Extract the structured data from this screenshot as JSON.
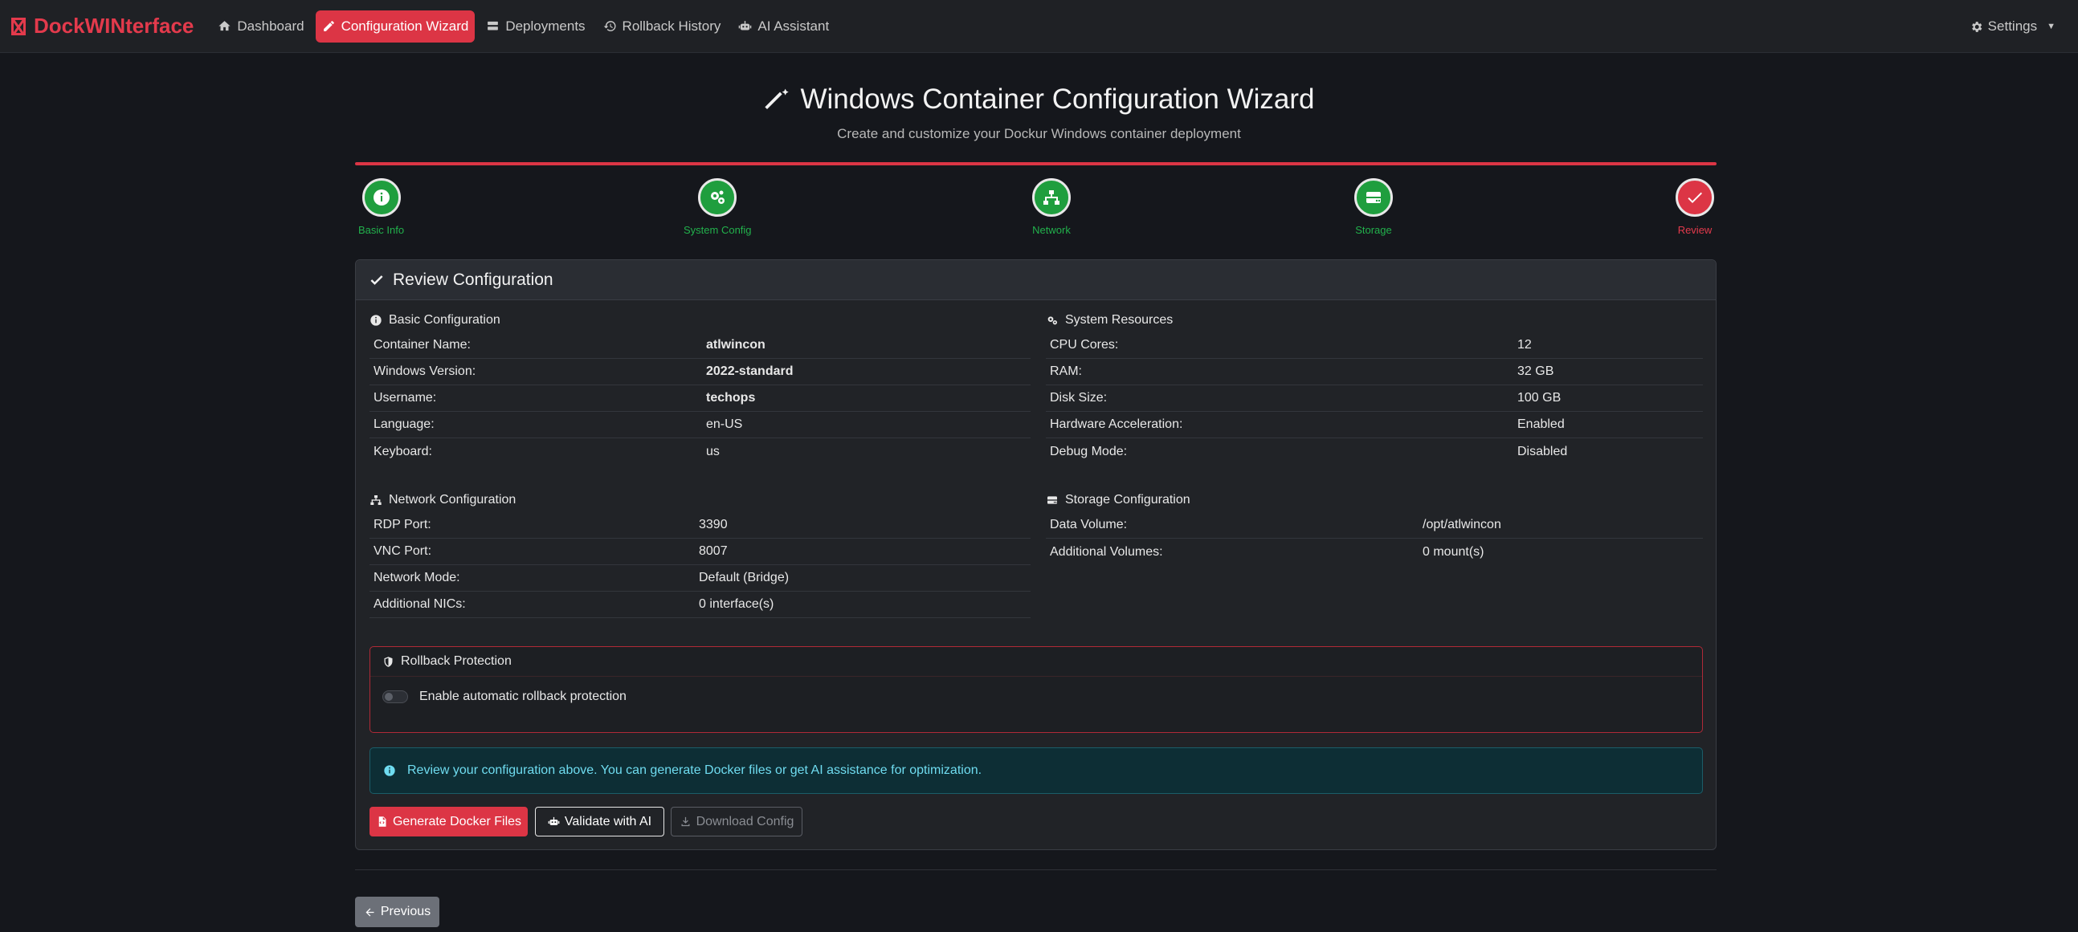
{
  "nav": {
    "brand": "DockWINterface",
    "items": [
      {
        "label": "Dashboard",
        "icon": "home-icon"
      },
      {
        "label": "Configuration Wizard",
        "icon": "pencil-icon"
      },
      {
        "label": "Deployments",
        "icon": "server-icon"
      },
      {
        "label": "Rollback History",
        "icon": "history-icon"
      },
      {
        "label": "AI Assistant",
        "icon": "robot-icon"
      }
    ],
    "settings": "Settings"
  },
  "header": {
    "title": "Windows Container Configuration Wizard",
    "subtitle": "Create and customize your Dockur Windows container deployment"
  },
  "steps": [
    {
      "label": "Basic Info",
      "icon": "info-icon",
      "status": "complete"
    },
    {
      "label": "System Config",
      "icon": "cogs-icon",
      "status": "complete"
    },
    {
      "label": "Network",
      "icon": "network-icon",
      "status": "complete"
    },
    {
      "label": "Storage",
      "icon": "hdd-icon",
      "status": "complete"
    },
    {
      "label": "Review",
      "icon": "check-icon",
      "status": "active"
    }
  ],
  "review": {
    "title": "Review Configuration",
    "basic": {
      "title": "Basic Configuration",
      "rows": [
        {
          "k": "Container Name:",
          "v": "atlwincon"
        },
        {
          "k": "Windows Version:",
          "v": "2022-standard"
        },
        {
          "k": "Username:",
          "v": "techops"
        },
        {
          "k": "Language:",
          "v": "en-US"
        },
        {
          "k": "Keyboard:",
          "v": "us"
        }
      ]
    },
    "system": {
      "title": "System Resources",
      "rows": [
        {
          "k": "CPU Cores:",
          "v": "12"
        },
        {
          "k": "RAM:",
          "v": "32 GB"
        },
        {
          "k": "Disk Size:",
          "v": "100 GB"
        },
        {
          "k": "Hardware Acceleration:",
          "v": "Enabled"
        },
        {
          "k": "Debug Mode:",
          "v": "Disabled"
        }
      ]
    },
    "network": {
      "title": "Network Configuration",
      "rows": [
        {
          "k": "RDP Port:",
          "v": "3390"
        },
        {
          "k": "VNC Port:",
          "v": "8007"
        },
        {
          "k": "Network Mode:",
          "v": "Default (Bridge)"
        },
        {
          "k": "Additional NICs:",
          "v": "0 interface(s)"
        }
      ]
    },
    "storage": {
      "title": "Storage Configuration",
      "rows": [
        {
          "k": "Data Volume:",
          "v": "/opt/atlwincon"
        },
        {
          "k": "Additional Volumes:",
          "v": "0 mount(s)"
        }
      ]
    },
    "rollback": {
      "title": "Rollback Protection",
      "toggle_label": "Enable automatic rollback protection",
      "enabled": false
    },
    "alert": "Review your configuration above. You can generate Docker files or get AI assistance for optimization.",
    "buttons": {
      "generate": "Generate Docker Files",
      "validate": "Validate with AI",
      "download": "Download Config"
    }
  },
  "previous": "Previous",
  "colors": {
    "accent": "#dc3545",
    "success": "#1f9e3e",
    "info_text": "#6fdcf0"
  }
}
